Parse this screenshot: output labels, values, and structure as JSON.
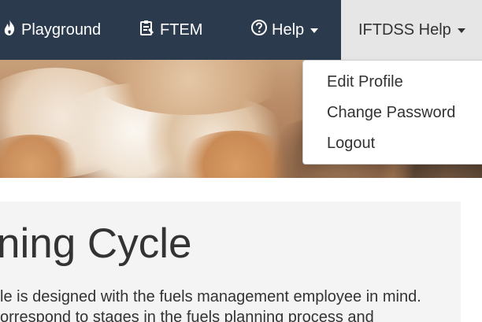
{
  "navbar": {
    "playground": {
      "label": "Playground",
      "icon": "flame-icon"
    },
    "ftem": {
      "label": "FTEM",
      "icon": "clipboard-icon"
    },
    "help": {
      "label": "Help",
      "icon": "question-circle-icon"
    },
    "user_menu": {
      "label": "IFTDSS Help",
      "icon": "caret-down-icon"
    }
  },
  "dropdown": {
    "items": [
      "Edit Profile",
      "Change Password",
      "Logout"
    ]
  },
  "panel": {
    "title_fragment": "ning Cycle",
    "line1": "le is designed with the fuels management employee in mind.",
    "line2": "orrespond to stages in the fuels planning process and"
  },
  "colors": {
    "navbar_bg": "#2b3a4d",
    "active_nav_bg": "#e6e6e6",
    "panel_bg": "#f4f4f4"
  }
}
